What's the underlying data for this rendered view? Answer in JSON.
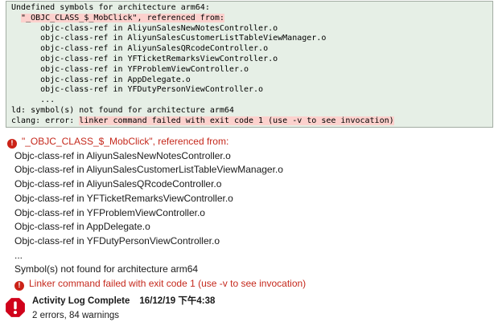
{
  "console": {
    "lines": [
      {
        "text": "Undefined symbols for architecture arm64:"
      },
      {
        "pre": "  ",
        "highlight": "\"_OBJC_CLASS_$_MobClick\", referenced from:"
      },
      {
        "text": "      objc-class-ref in AliyunSalesNewNotesController.o"
      },
      {
        "text": "      objc-class-ref in AliyunSalesCustomerListTableViewManager.o"
      },
      {
        "text": "      objc-class-ref in AliyunSalesQRcodeController.o"
      },
      {
        "text": "      objc-class-ref in YFTicketRemarksViewController.o"
      },
      {
        "text": "      objc-class-ref in YFProblemViewController.o"
      },
      {
        "text": "      objc-class-ref in AppDelegate.o"
      },
      {
        "text": "      objc-class-ref in YFDutyPersonViewController.o"
      },
      {
        "text": "      ..."
      },
      {
        "text": "ld: symbol(s) not found for architecture arm64"
      },
      {
        "pre": "clang: error: ",
        "highlight": "linker command failed with exit code 1 (use -v to see invocation)"
      }
    ]
  },
  "issues": {
    "error_symbol": "\"_OBJC_CLASS_$_MobClick\", referenced from:",
    "refs": [
      "Objc-class-ref in AliyunSalesNewNotesController.o",
      "Objc-class-ref in AliyunSalesCustomerListTableViewManager.o",
      "Objc-class-ref in AliyunSalesQRcodeController.o",
      "Objc-class-ref in YFTicketRemarksViewController.o",
      "Objc-class-ref in YFProblemViewController.o",
      "Objc-class-ref in AppDelegate.o",
      "Objc-class-ref in YFDutyPersonViewController.o"
    ],
    "ellipsis": "...",
    "symbol_line": "Symbol(s) not found for architecture arm64",
    "linker_line": "Linker command failed with exit code 1 (use -v to see invocation)",
    "error_badge_glyph": "!"
  },
  "footer": {
    "title": "Activity Log Complete",
    "timestamp": "16/12/19 下午4:38",
    "summary": "2 errors, 84 warnings"
  },
  "icons": {
    "error_circle": "error-circle-icon",
    "error_octagon": "stop-error-icon"
  },
  "colors": {
    "console_bg": "#e6efe6",
    "console_border": "#a2aca2",
    "highlight_pink": "#fcd1cd",
    "error_red": "#c5281c",
    "badge_red": "#cb2217",
    "octagon_red": "#d0021b"
  }
}
